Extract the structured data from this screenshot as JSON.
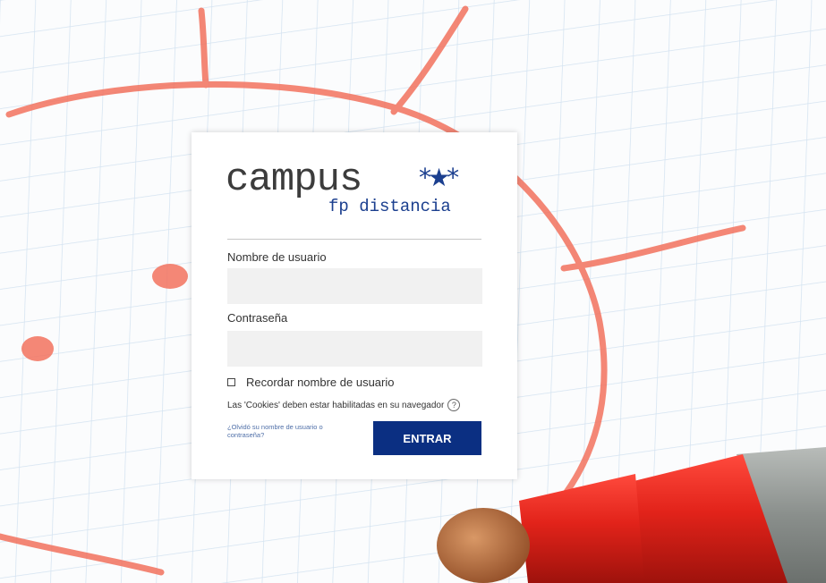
{
  "background": {
    "grid_color": "#cfe0ef",
    "drawing_color": "#f2725e",
    "marker_body_color": "#e2231a",
    "marker_tip_color": "#b7683c",
    "marker_barrel_color": "#8a8f8c"
  },
  "logo": {
    "word": "campus",
    "stars": "*★*",
    "subtitle": "fp distancia",
    "primary_color": "#3c3c3c",
    "accent_color": "#1b3f8f"
  },
  "login": {
    "username_label": "Nombre de usuario",
    "username_value": "",
    "password_label": "Contraseña",
    "password_value": "",
    "remember_label": "Recordar nombre de usuario",
    "remember_checked": false,
    "cookies_notice": "Las 'Cookies' deben estar habilitadas en su navegador",
    "help_icon": "question-circle-icon",
    "help_glyph": "?",
    "forgot_link": "¿Olvidó su nombre de usuario o contraseña?",
    "submit_label": "ENTRAR",
    "submit_color": "#0b2f82"
  }
}
